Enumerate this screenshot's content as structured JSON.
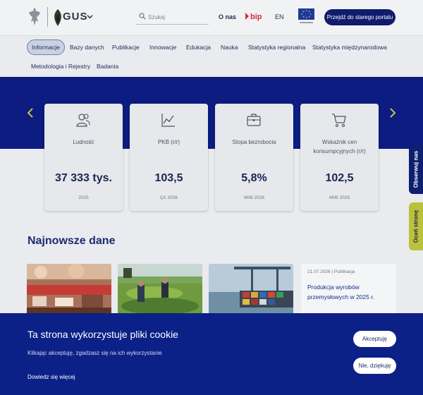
{
  "header": {
    "logo_text": "GUS",
    "search_placeholder": "Szukaj",
    "about": "O nas",
    "bip": "bip",
    "language": "EN",
    "old_portal": "Przejdź do starego portalu"
  },
  "nav": {
    "items": [
      {
        "label": "Informacje",
        "active": true
      },
      {
        "label": "Bazy danych"
      },
      {
        "label": "Publikacje"
      },
      {
        "label": "Innowacje"
      },
      {
        "label": "Edukacja"
      },
      {
        "label": "Nauka"
      },
      {
        "label": "Statystyka regionalna"
      },
      {
        "label": "Statystyka międzynarodowa"
      },
      {
        "label": "Metodologia i Rejestry"
      },
      {
        "label": "Badania"
      }
    ]
  },
  "indicators": [
    {
      "icon": "people-icon",
      "label": "Ludność",
      "value": "37 333 tys.",
      "period": "2025"
    },
    {
      "icon": "chart-line-icon",
      "label": "PKB (r/r)",
      "value": "103,5",
      "period": "Q1 2026"
    },
    {
      "icon": "briefcase-icon",
      "label": "Stopa bezrobocia",
      "value": "5,8%",
      "period": "M06 2026"
    },
    {
      "icon": "cart-icon",
      "label": "Wskaźnik cen konsumpcyjnych (r/r)",
      "value": "102,5",
      "period": "M06 2026"
    }
  ],
  "side_tabs": {
    "observe": "Obserwuj nas",
    "rate": "Oceń stronę"
  },
  "latest": {
    "title": "Najnowsze dane",
    "news": {
      "date": "21.07.2026",
      "type": "Publikacja",
      "meta": "21.07.2026 | Publikacja",
      "title": "Produkcja wyrobów przemysłowych w 2025 r."
    }
  },
  "cookie": {
    "title": "Ta strona wykorzystuje pliki cookie",
    "text": "Klikając akceptuję, zgadzasz się na ich wykorzystanie",
    "more": "Dowiedz się więcej",
    "accept": "Akceptuję",
    "decline": "Nie, dziękuję"
  },
  "colors": {
    "brand_navy": "#0c1c80",
    "cookie_bg": "#0b2187",
    "rate_tab": "#b9c23a",
    "bip_red": "#d52b3a"
  }
}
